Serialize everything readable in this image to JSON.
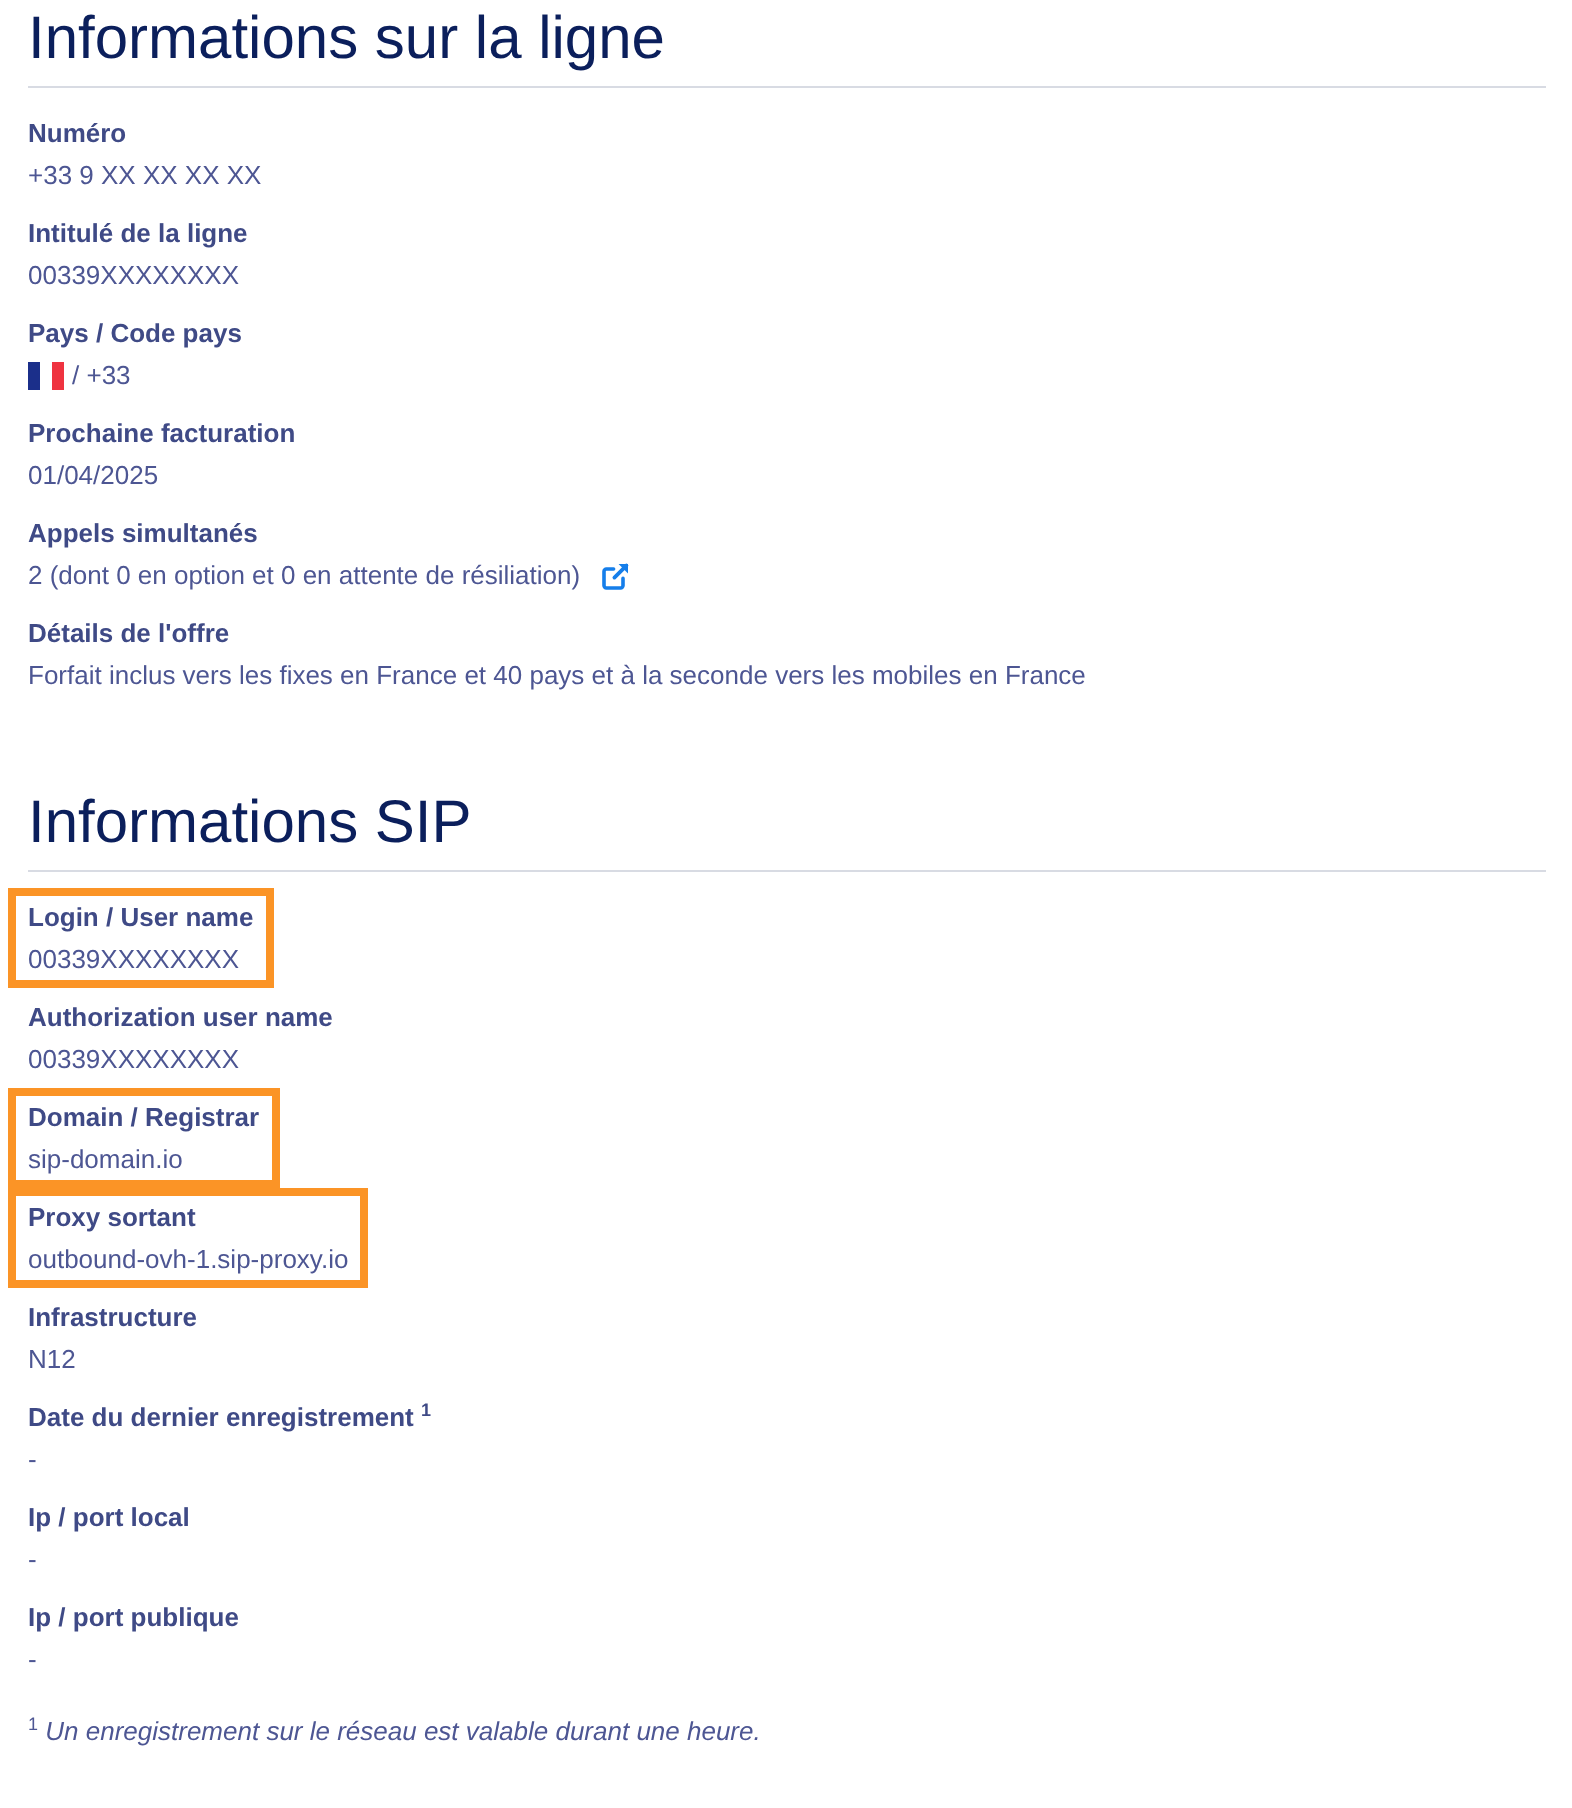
{
  "sections": [
    {
      "title": "Informations sur la ligne",
      "fields": [
        {
          "label": "Numéro",
          "value": "+33 9 XX XX XX XX",
          "kind": "text",
          "highlighted": false
        },
        {
          "label": "Intitulé de la ligne",
          "value": "00339XXXXXXXX",
          "kind": "text",
          "highlighted": false
        },
        {
          "label": "Pays / Code pays",
          "value": "/ +33",
          "kind": "flag",
          "highlighted": false
        },
        {
          "label": "Prochaine facturation",
          "value": "01/04/2025",
          "kind": "text",
          "highlighted": false
        },
        {
          "label": "Appels simultanés",
          "value": "2 (dont 0 en option et 0 en attente de résiliation)",
          "kind": "link",
          "highlighted": false
        },
        {
          "label": "Détails de l'offre",
          "value": "Forfait inclus vers les fixes en France et 40 pays et à la seconde vers les mobiles en France",
          "kind": "text",
          "highlighted": false
        }
      ]
    },
    {
      "title": "Informations SIP",
      "fields": [
        {
          "label": "Login / User name",
          "value": "00339XXXXXXXX",
          "kind": "text",
          "highlighted": true
        },
        {
          "label": "Authorization user name",
          "value": "00339XXXXXXXX",
          "kind": "text",
          "highlighted": false
        },
        {
          "label": "Domain / Registrar",
          "value": "sip-domain.io",
          "kind": "text",
          "highlighted": true
        },
        {
          "label": "Proxy sortant",
          "value": "outbound-ovh-1.sip-proxy.io",
          "kind": "text",
          "highlighted": true
        },
        {
          "label": "Infrastructure",
          "value": "N12",
          "kind": "text",
          "highlighted": false
        },
        {
          "label": "Date du dernier enregistrement $^{1}$",
          "value": "-",
          "kind": "text",
          "highlighted": false
        },
        {
          "label": "Ip / port local",
          "value": "-",
          "kind": "text",
          "highlighted": false
        },
        {
          "label": "Ip / port publique",
          "value": "-",
          "kind": "text",
          "highlighted": false
        }
      ]
    }
  ],
  "footnote": "$^{1}$ *Un enregistrement sur le réseau est valable durant une heure.*"
}
